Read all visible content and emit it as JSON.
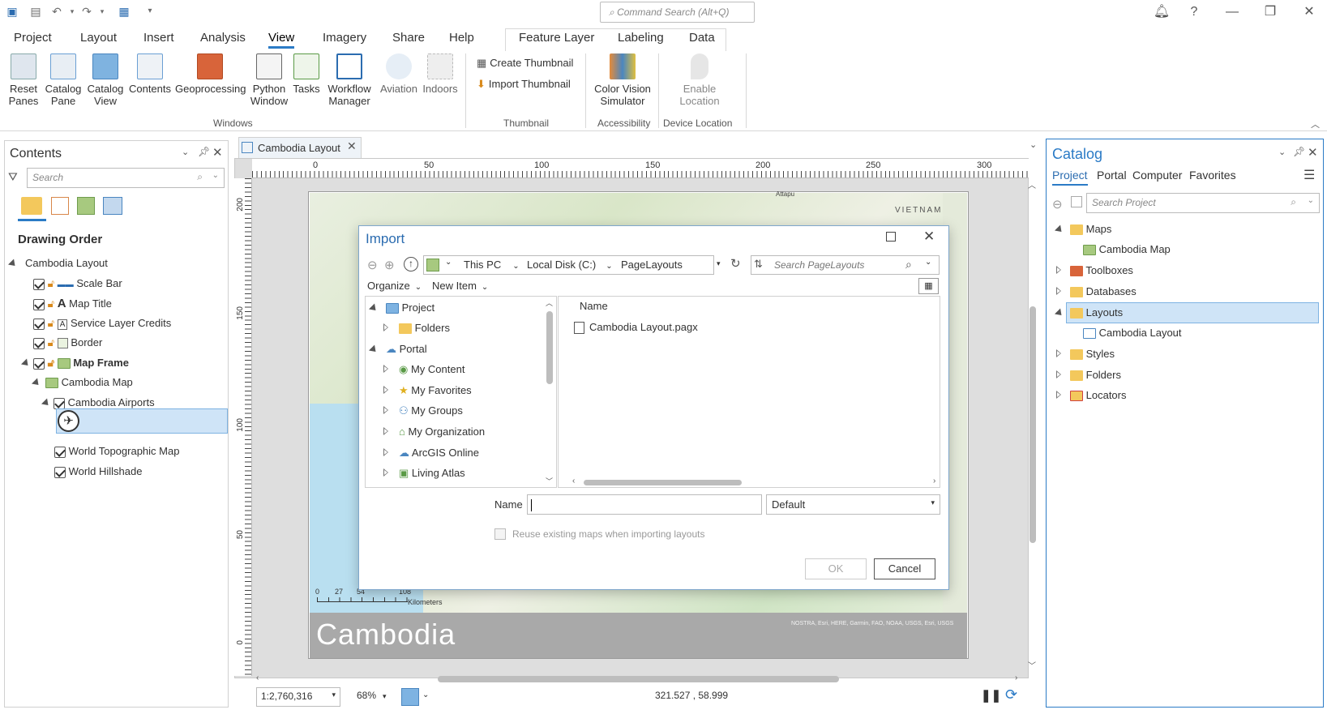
{
  "qat": {
    "command_search_placeholder": "Command Search (Alt+Q)"
  },
  "menu": {
    "tabs": [
      "Project",
      "Layout",
      "Insert",
      "Analysis",
      "View",
      "Imagery",
      "Share",
      "Help"
    ],
    "active": "View",
    "context_tabs": [
      "Feature Layer",
      "Labeling",
      "Data"
    ]
  },
  "ribbon": {
    "windows": [
      "Reset\nPanes",
      "Catalog\nPane",
      "Catalog\nView",
      "Contents",
      "Geoprocessing",
      "Python\nWindow",
      "Tasks",
      "Workflow\nManager",
      "Aviation",
      "Indoors"
    ],
    "windows_group": "Windows",
    "thumbnail": {
      "create": "Create Thumbnail",
      "import": "Import Thumbnail",
      "group": "Thumbnail"
    },
    "accessibility": {
      "button": "Color Vision\nSimulator",
      "group": "Accessibility"
    },
    "device": {
      "button": "Enable\nLocation",
      "group": "Device Location"
    }
  },
  "contents": {
    "title": "Contents",
    "search_placeholder": "Search",
    "section": "Drawing Order",
    "layout": "Cambodia Layout",
    "items": [
      {
        "label": "Scale Bar"
      },
      {
        "label": "Map Title"
      },
      {
        "label": "Service Layer Credits"
      },
      {
        "label": "Border"
      },
      {
        "label": "Map Frame"
      }
    ],
    "map": "Cambodia Map",
    "layer": "Cambodia Airports",
    "basemaps": [
      "World Topographic Map",
      "World Hillshade"
    ]
  },
  "layout_tab": {
    "title": "Cambodia Layout"
  },
  "ruler": {
    "h": [
      "0",
      "50",
      "100",
      "150",
      "200",
      "250",
      "300"
    ],
    "v": [
      "200",
      "150",
      "100",
      "50",
      "0"
    ]
  },
  "map": {
    "label_attapu": "Attapu",
    "label_vietnam": "VIETNAM",
    "title": "Cambodia",
    "credits": "NOSTRA, Esri, HERE, Garmin, FAO, NOAA, USGS, Esri, USGS",
    "scale_ticks": [
      "0",
      "27",
      "54",
      "108"
    ],
    "scale_unit": "Kilometers"
  },
  "dialog": {
    "title": "Import",
    "path": [
      "This PC",
      "Local Disk (C:)",
      "PageLayouts"
    ],
    "search_placeholder": "Search PageLayouts",
    "organize": "Organize",
    "new_item": "New Item",
    "tree": [
      "Project",
      "Folders",
      "Portal",
      "My Content",
      "My Favorites",
      "My Groups",
      "My Organization",
      "ArcGIS Online",
      "Living Atlas"
    ],
    "column": "Name",
    "files": [
      "Cambodia Layout.pagx"
    ],
    "name_label": "Name",
    "name_value": "",
    "filter": "Default",
    "reuse": "Reuse existing maps when importing layouts",
    "ok": "OK",
    "cancel": "Cancel"
  },
  "status": {
    "scale": "1:2,760,316",
    "zoom": "68%",
    "coords": "321.527 , 58.999"
  },
  "catalog": {
    "title": "Catalog",
    "tabs": [
      "Project",
      "Portal",
      "Computer",
      "Favorites"
    ],
    "active_tab": "Project",
    "search_placeholder": "Search Project",
    "items": [
      "Maps",
      "Cambodia Map",
      "Toolboxes",
      "Databases",
      "Layouts",
      "Cambodia Layout",
      "Styles",
      "Folders",
      "Locators"
    ]
  }
}
